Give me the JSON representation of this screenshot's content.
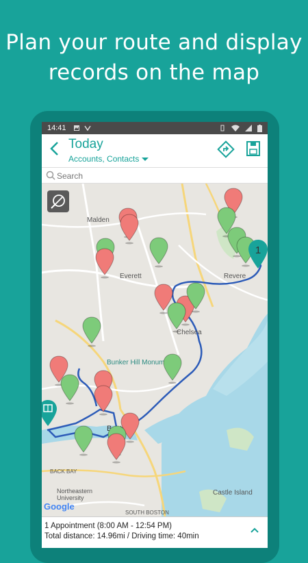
{
  "headline": {
    "line1": "Plan your route and display",
    "line2": "records on the map"
  },
  "statusbar": {
    "time": "14:41"
  },
  "appbar": {
    "title": "Today",
    "subtitle": "Accounts, Contacts",
    "icons": [
      "back-icon",
      "route-icon",
      "save-icon"
    ]
  },
  "search": {
    "placeholder": "Search"
  },
  "map": {
    "places": {
      "malden": "Malden",
      "everett": "Everett",
      "revere": "Revere",
      "chelsea": "Chelsea",
      "bunker": "Bunker Hill Monument",
      "boston": "Boston",
      "backbay": "BACK BAY",
      "northeastern": "Northeastern University",
      "castle": "Castle Island",
      "southboston": "SOUTH BOSTON"
    },
    "route_number": "1",
    "google": "Google",
    "colors": {
      "red_pin": "#f07b78",
      "green_pin": "#7dcb7a",
      "route": "#2c5bb8",
      "teal_pin": "#18a39a"
    }
  },
  "bottom": {
    "line1": "1 Appointment (8:00 AM - 12:54 PM)",
    "line2": "Total distance: 14.96mi / Driving time: 40min"
  }
}
